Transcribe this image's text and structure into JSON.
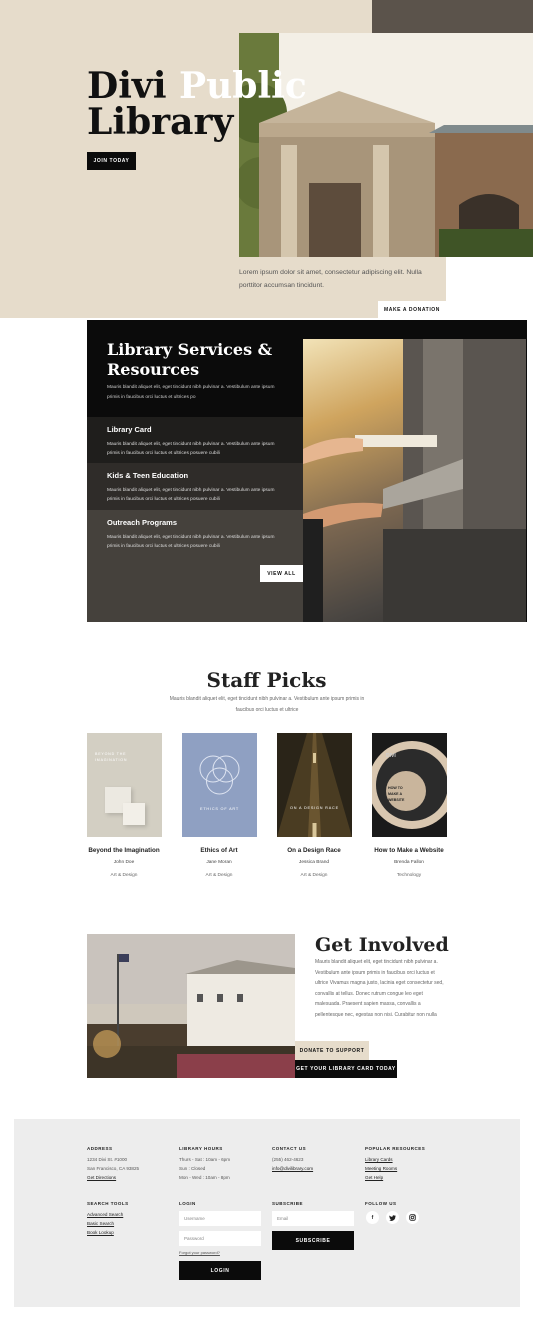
{
  "hero": {
    "title_line1_a": "Divi",
    "title_line1_b": "Public",
    "title_line2": "Library",
    "join_button": "JOIN TODAY",
    "description": "Lorem ipsum dolor sit amet, consectetur adipiscing elit. Nulla porttitor accumsan tincidunt.",
    "donate_button": "MAKE A DONATION"
  },
  "services": {
    "title": "Library Services & Resources",
    "intro": "Mauris blandit aliquet elit, eget tincidunt nibh pulvinar a. Vestibulum ante ipsum primis in faucibus orci luctus et ultrices po",
    "items": [
      {
        "title": "Library Card",
        "text": "Mauris blandit aliquet elit, eget tincidunt nibh pulvinar a. Vestibulum ante ipsum primis in faucibus orci luctus et ultrices posuere cubili"
      },
      {
        "title": "Kids & Teen Education",
        "text": "Mauris blandit aliquet elit, eget tincidunt nibh pulvinar a. Vestibulum ante ipsum primis in faucibus orci luctus et ultrices posuere cubili"
      },
      {
        "title": "Outreach Programs",
        "text": "Mauris blandit aliquet elit, eget tincidunt nibh pulvinar a. Vestibulum ante ipsum primis in faucibus orci luctus et ultrices posuere cubili"
      }
    ],
    "view_all_button": "VIEW ALL"
  },
  "staff_picks": {
    "title": "Staff Picks",
    "intro": "Mauris blandit aliquet elit, eget tincidunt nibh pulvinar a. Vestibulum ante ipsum primis in faucibus orci luctus et ultrice",
    "books": [
      {
        "title": "Beyond the Imagination",
        "author": "John Doe",
        "genre": "Art & Design",
        "cover_text": "BEYOND THE IMAGINATION"
      },
      {
        "title": "Ethics of Art",
        "author": "Jane Moran",
        "genre": "Art & Design",
        "cover_text": "ETHICS OF ART"
      },
      {
        "title": "On a Design Race",
        "author": "Jessica Brand",
        "genre": "Art & Design",
        "cover_text": "ON A DESIGN RACE"
      },
      {
        "title": "How to Make a Website",
        "author": "Brenda Fallon",
        "genre": "Technology",
        "cover_text": "HOW TO MAKE A WEBSITE",
        "cover_brand": "DIVI"
      }
    ]
  },
  "get_involved": {
    "title": "Get Involved",
    "text": "Mauris blandit aliquet elit, eget tincidunt nibh pulvinar a. Vestibulum ante ipsum primis in faucibus orci luctus et ultrice Vivamus magna justo, lacinia eget consectetur sed, convallis at tellus. Donec rutrum congue leo eget malesuada. Praesent sapien massa, convallis a pellentesque nec, egestas non nisi. Curabitur non nulla",
    "donate_button": "DONATE TO SUPPORT",
    "card_button": "GET YOUR LIBRARY CARD TODAY"
  },
  "footer": {
    "address": {
      "heading": "ADDRESS",
      "line1": "1234 Divi St. #1000",
      "line2": "San Francisco, CA 93825",
      "link": "Get Directions"
    },
    "hours": {
      "heading": "LIBRARY HOURS",
      "line1": "Thurs - Sat : 10am - 6pm",
      "line2": "Sun : Closed",
      "line3": "Mon - Wed : 10am - 8pm"
    },
    "contact": {
      "heading": "CONTACT US",
      "phone": "(255) 462-4623",
      "email": "info@divilibrary.com"
    },
    "resources": {
      "heading": "POPULAR RESOURCES",
      "links": [
        "Library Cards",
        "Meeting Rooms",
        "Get Help"
      ]
    },
    "search_tools": {
      "heading": "SEARCH TOOLS",
      "links": [
        "Advanced Search",
        "Basic Search",
        "Book Lookup"
      ]
    },
    "login": {
      "heading": "LOGIN",
      "username_placeholder": "Username",
      "password_placeholder": "Password",
      "forgot": "Forgot your password?",
      "button": "LOGIN"
    },
    "subscribe": {
      "heading": "SUBSCRIBE",
      "email_placeholder": "Email",
      "button": "SUBSCRIBE"
    },
    "follow": {
      "heading": "FOLLOW US",
      "icons": [
        "facebook-icon",
        "twitter-icon",
        "instagram-icon"
      ]
    }
  },
  "colors": {
    "beige": "#e6dccb",
    "dark": "#0b0b0b",
    "taupe": "#5b534b",
    "footer_bg": "#ededed"
  }
}
